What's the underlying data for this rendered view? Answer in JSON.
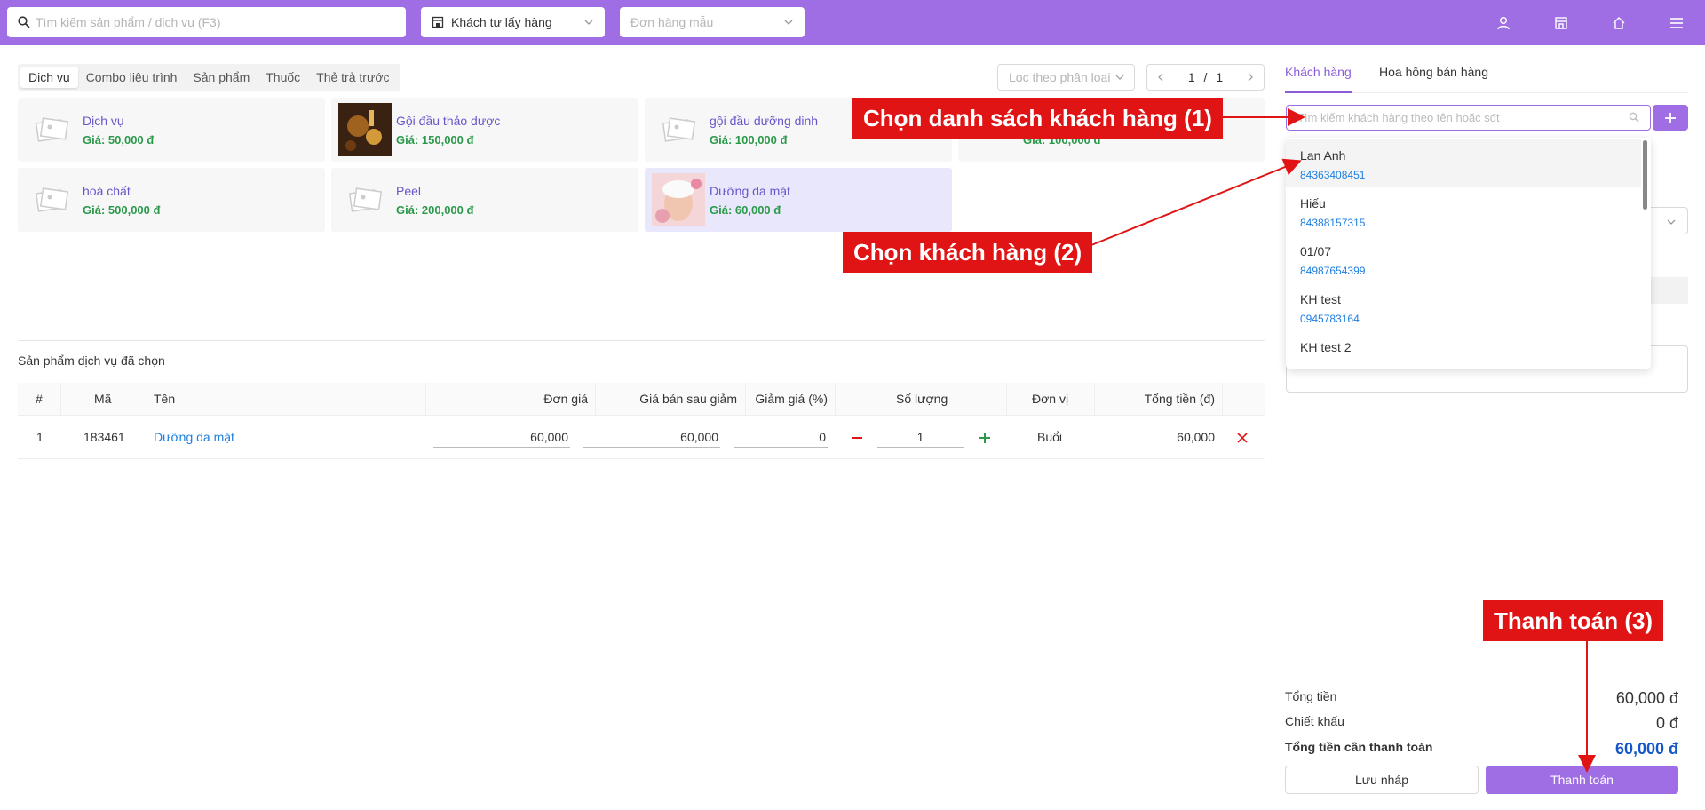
{
  "topbar": {
    "search_placeholder": "Tìm kiếm sản phẩm / dịch vụ (F3)",
    "delivery_select": "Khách tự lấy hàng",
    "template_placeholder": "Đơn hàng mẫu",
    "background": "#a06ee4"
  },
  "categories": [
    "Dịch vụ",
    "Combo liệu trình",
    "Sản phẩm",
    "Thuốc",
    "Thẻ trả trước"
  ],
  "filter_placeholder": "Lọc theo phân loại",
  "pager": {
    "current": "1",
    "sep": "/",
    "total": "1"
  },
  "products": [
    {
      "name": "Dịch vụ",
      "price": "Giá: 50,000 đ"
    },
    {
      "name": "Gội đầu thảo dược",
      "price": "Giá: 150,000 đ"
    },
    {
      "name": "gội đầu dưỡng dinh",
      "price": "Giá: 100,000 đ"
    },
    {
      "name": "",
      "price": "Giá: 100,000 đ"
    },
    {
      "name": "hoá chất",
      "price": "Giá: 500,000 đ"
    },
    {
      "name": "Peel",
      "price": "Giá: 200,000 đ"
    },
    {
      "name": "Dưỡng da mặt",
      "price": "Giá: 60,000 đ"
    }
  ],
  "selected_section_title": "Sản phẩm dịch vụ đã chọn",
  "table": {
    "headers": [
      "#",
      "Mã",
      "Tên",
      "Đơn giá",
      "Giá bán sau giảm",
      "Giảm giá (%)",
      "Số lượng",
      "Đơn vị",
      "Tổng tiền (đ)"
    ],
    "rows": [
      {
        "index": "1",
        "code": "183461",
        "name": "Dưỡng da mặt",
        "unit_price": "60,000",
        "sale_price": "60,000",
        "discount": "0",
        "qty": "1",
        "unit": "Buổi",
        "total": "60,000"
      }
    ]
  },
  "right_panel": {
    "tabs": [
      "Khách hàng",
      "Hoa hồng bán hàng"
    ],
    "customer_search_placeholder": "Tìm kiếm khách hàng theo tên hoặc sđt",
    "customers": [
      {
        "name": "Lan Anh",
        "phone": "84363408451"
      },
      {
        "name": "Hiếu",
        "phone": "84388157315"
      },
      {
        "name": "01/07",
        "phone": "84987654399"
      },
      {
        "name": "KH test",
        "phone": "0945783164"
      },
      {
        "name": "KH test 2",
        "phone": ""
      }
    ],
    "summary": {
      "total_label": "Tổng tiền",
      "total_value": "60,000 đ",
      "discount_label": "Chiết khấu",
      "discount_value": "0 đ",
      "payable_label": "Tổng tiền cần thanh toán",
      "payable_value": "60,000 đ"
    },
    "draft_button": "Lưu nháp",
    "pay_button": "Thanh toán"
  },
  "annotations": {
    "step1": "Chọn danh sách khách hàng (1)",
    "step2": "Chọn khách hàng (2)",
    "step3": "Thanh toán (3)",
    "color": "#e01414"
  }
}
